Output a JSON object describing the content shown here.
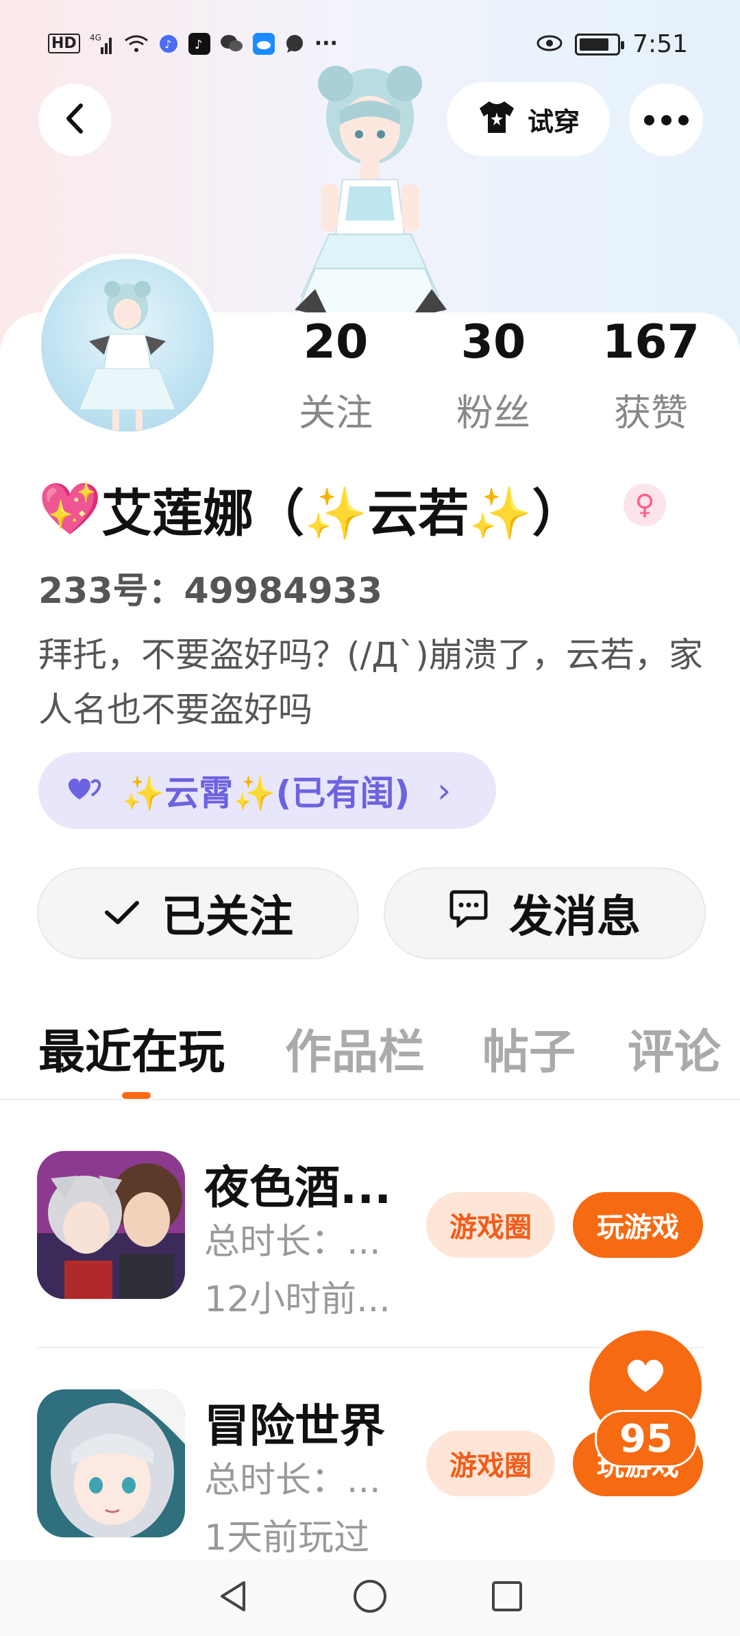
{
  "status_bar": {
    "network": "HD",
    "signal": "4G",
    "time": "7:51",
    "icons": [
      "hd-icon",
      "signal-icon",
      "wifi-icon",
      "music-icon",
      "tiktok-icon",
      "wechat-icon",
      "cloud-icon",
      "chat-icon",
      "more-dots-icon"
    ]
  },
  "header": {
    "tryon_label": "试穿"
  },
  "stats": [
    {
      "value": "20",
      "label": "关注"
    },
    {
      "value": "30",
      "label": "粉丝"
    },
    {
      "value": "167",
      "label": "获赞"
    }
  ],
  "profile": {
    "name_emoji": "💖",
    "name": "艾莲娜（✨云若✨）",
    "uid": "233号：49984933",
    "bio": "拜托，不要盗好吗？(/Д`)崩溃了，云若，家人名也不要盗好吗",
    "partner": "✨云霄✨(已有闺)",
    "partner_chevron": "›"
  },
  "actions": {
    "followed_label": "已关注",
    "message_label": "发消息"
  },
  "tabs": [
    "最近在玩",
    "作品栏",
    "帖子",
    "评论"
  ],
  "games": [
    {
      "title": "夜色酒...",
      "duration": "总时长：...",
      "last_played": "12小时前...",
      "circle_label": "游戏圈",
      "play_label": "玩游戏"
    },
    {
      "title": "冒险世界",
      "duration": "总时长：...",
      "last_played": "1天前玩过",
      "circle_label": "游戏圈",
      "play_label": "玩游戏"
    }
  ],
  "like_count": "95",
  "colors": {
    "accent": "#f66a12",
    "partner_bg": "#e8e6fb",
    "partner_text": "#6c63e0"
  }
}
